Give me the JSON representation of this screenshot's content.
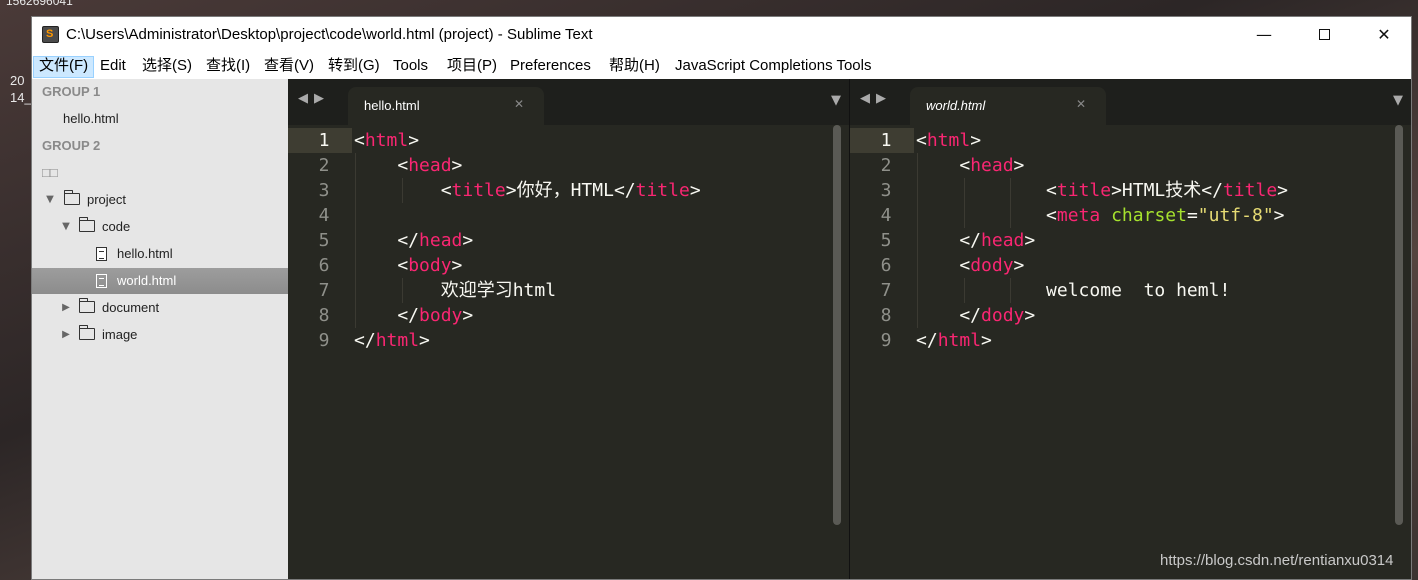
{
  "desktop": {
    "top_text": "1562696041",
    "left_text_1": "20",
    "left_text_2": "14_"
  },
  "window": {
    "title": "C:\\Users\\Administrator\\Desktop\\project\\code\\world.html (project) - Sublime Text",
    "app_icon": "sublime-text-icon"
  },
  "menu": [
    {
      "label": "文件(F)",
      "active": true
    },
    {
      "label": "Edit"
    },
    {
      "label": "选择(S)"
    },
    {
      "label": "查找(I)"
    },
    {
      "label": "查看(V)"
    },
    {
      "label": "转到(G)"
    },
    {
      "label": "Tools"
    },
    {
      "label": "项目(P)"
    },
    {
      "label": "Preferences"
    },
    {
      "label": "帮助(H)"
    },
    {
      "label": "JavaScript Completions Tools"
    }
  ],
  "sidebar": {
    "group1_header": "GROUP 1",
    "group1_file": "hello.html",
    "group2_header": "GROUP 2",
    "folders_header": "□□",
    "tree": {
      "project": "project",
      "code": "code",
      "hello": "hello.html",
      "world": "world.html",
      "document": "document",
      "image": "image"
    },
    "selected": "world.html"
  },
  "left_pane": {
    "tab_label": "hello.html",
    "line_numbers": [
      "1",
      "2",
      "3",
      "4",
      "5",
      "6",
      "7",
      "8",
      "9"
    ],
    "current_line": "1",
    "text": {
      "title_text": "你好，HTML",
      "body_text": "欢迎学习html"
    }
  },
  "right_pane": {
    "tab_label": "world.html",
    "line_numbers": [
      "1",
      "2",
      "3",
      "4",
      "5",
      "6",
      "7",
      "8",
      "9"
    ],
    "current_line": "1",
    "text": {
      "title_text": "HTML技术",
      "meta_attr": "charset",
      "meta_value": "\"utf-8\"",
      "body_text": "welcome  to heml!"
    }
  },
  "watermark": "https://blog.csdn.net/rentianxu0314",
  "colors": {
    "editor_bg": "#272822",
    "tag": "#f92672",
    "attr": "#a6e22e",
    "string": "#e6db74",
    "text": "#f8f8f2",
    "sidebar_bg": "#e6e6e6"
  }
}
